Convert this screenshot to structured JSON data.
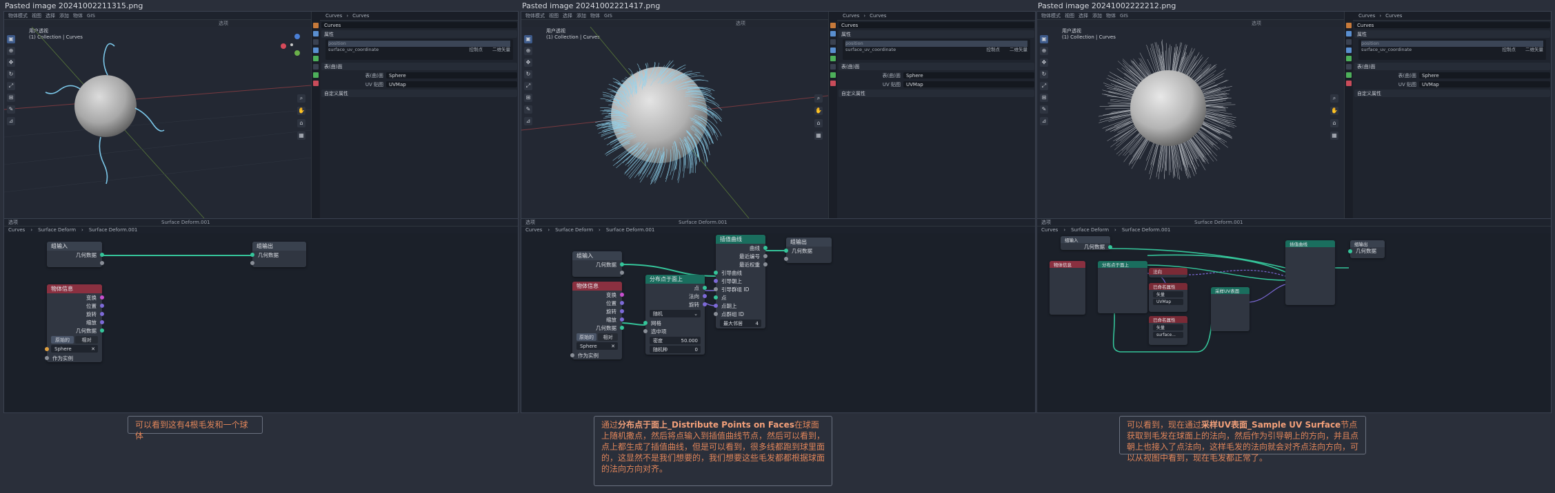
{
  "panels": [
    {
      "caption": "Pasted image 20241002211315.png",
      "viewport": {
        "mode": "物体模式",
        "menu": [
          "视图",
          "选择",
          "添加",
          "物体",
          "GIS"
        ],
        "info1": "用户透视",
        "info2": "(1) Collection | Curves",
        "select_label": "选项"
      },
      "props": {
        "crumb1": "Curves",
        "crumb2": "Curves",
        "name": "Curves",
        "sec_attr": "属性",
        "attr_row1": "position",
        "attr_row2": "surface_uv_coordinate",
        "attr_row2b": "控制点",
        "attr_row2c": "二维矢量",
        "sec_surface": "表(曲)面",
        "surface_label": "表(曲)面",
        "surface_value": "Sphere",
        "uv_label": "UV 贴图",
        "uv_value": "UVMap",
        "sec_custom": "自定义属性"
      },
      "editor": {
        "name": "Surface Deform.001",
        "crumbs": [
          "Curves",
          "Surface Deform",
          "Surface Deform.001"
        ]
      },
      "nodes": {
        "group_in": "组输入",
        "group_out": "组输出",
        "geometry": "几何数据",
        "obj_info": "物体信息",
        "transform": "变换",
        "location": "位置",
        "rotation": "旋转",
        "scale": "缩放",
        "orig": "原始的",
        "rel": "相对",
        "sphere": "Sphere",
        "instance": "作为实例"
      },
      "note": {
        "text": "可以看到这有4根毛发和一个球体"
      }
    },
    {
      "caption": "Pasted image 20241002221417.png",
      "viewport": {
        "mode": "物体模式",
        "menu": [
          "视图",
          "选择",
          "添加",
          "物体",
          "GIS"
        ],
        "info1": "用户透视",
        "info2": "(1) Collection | Curves",
        "select_label": "选项"
      },
      "props": {
        "crumb1": "Curves",
        "crumb2": "Curves",
        "name": "Curves",
        "sec_attr": "属性",
        "attr_row1": "position",
        "attr_row2": "surface_uv_coordinate",
        "attr_row2b": "控制点",
        "attr_row2c": "二维矢量",
        "sec_surface": "表(曲)面",
        "surface_label": "表(曲)面",
        "surface_value": "Sphere",
        "uv_label": "UV 贴图",
        "uv_value": "UVMap",
        "sec_custom": "自定义属性"
      },
      "editor": {
        "name": "Surface Deform.001",
        "crumbs": [
          "Curves",
          "Surface Deform",
          "Surface Deform.001"
        ]
      },
      "nodes": {
        "group_in": "组输入",
        "group_out": "组输出",
        "geometry": "几何数据",
        "obj_info": "物体信息",
        "transform": "变换",
        "location": "位置",
        "rotation": "旋转",
        "scale": "缩放",
        "orig": "原始的",
        "rel": "相对",
        "sphere": "Sphere",
        "instance": "作为实例",
        "distribute": "分布点于面上",
        "dist_points": "点",
        "dist_normal": "法向",
        "dist_rotation": "旋转",
        "dist_mode": "随机",
        "dist_mesh": "网格",
        "dist_selection": "选中项",
        "dist_density": "密度",
        "dist_density_val": "50.000",
        "dist_seed": "随机种",
        "dist_seed_val": "0",
        "interp": "插值曲线",
        "interp_curves": "曲线",
        "interp_closest_idx": "最近编号",
        "interp_closest_w": "最近权重",
        "interp_guide": "引导曲线",
        "interp_guide_up": "引导朝上",
        "interp_guide_gid": "引导群组 ID",
        "interp_points": "点",
        "interp_point_up": "点朝上",
        "interp_point_gid": "点群组 ID",
        "interp_max": "最大邻居",
        "interp_max_val": "4"
      },
      "note": {
        "p1": "通过",
        "h1": "分布点于面上_Distribute Points on Faces",
        "p2": "在球面上随机撒点，然后将点输入到插值曲线节点，然后可以看到，点上都生成了插值曲线，但是可以看到，很多线都跑到球里面的，这显然不是我们想要的，我们想要这些毛发都都根据球面的法向方向对齐。"
      }
    },
    {
      "caption": "Pasted image 20241002222212.png",
      "viewport": {
        "mode": "物体模式",
        "menu": [
          "视图",
          "选择",
          "添加",
          "物体",
          "GIS"
        ],
        "info1": "用户透视",
        "info2": "(1) Collection | Curves",
        "select_label": "选项"
      },
      "props": {
        "crumb1": "Curves",
        "crumb2": "Curves",
        "name": "Curves",
        "sec_attr": "属性",
        "attr_row1": "position",
        "attr_row2": "surface_uv_coordinate",
        "attr_row2b": "控制点",
        "attr_row2c": "二维矢量",
        "sec_surface": "表(曲)面",
        "surface_label": "表(曲)面",
        "surface_value": "Sphere",
        "uv_label": "UV 贴图",
        "uv_value": "UVMap",
        "sec_custom": "自定义属性"
      },
      "editor": {
        "name": "Surface Deform.001",
        "crumbs": [
          "Curves",
          "Surface Deform",
          "Surface Deform.001"
        ]
      },
      "nodes": {
        "group_in": "组输入",
        "group_out": "组输出",
        "geometry": "几何数据",
        "obj_info": "物体信息",
        "sample_uv": "采样UV表面",
        "normal": "法向",
        "named_attr": "已命名属性",
        "named_attr2": "已命名属性",
        "vector": "矢量",
        "uvmap": "UVMap",
        "surface": "surface...",
        "distribute": "分布点于面上",
        "interp": "插值曲线"
      },
      "note": {
        "p1": "可以看到，现在通过",
        "h1": "采样UV表面_Sample UV Surface",
        "p2": "节点获取到毛发在球面上的法向，然后作为引导朝上的方向，并且点朝上也接入了点法向，这样毛发的法向就会对齐点法向方向，可以从视图中看到，现在毛发都正常了。"
      }
    }
  ],
  "colors": {
    "accent": "#35c59a",
    "note": "#e0855a",
    "hair": "#7cc8ea",
    "hair_white": "#d7dbe0"
  }
}
